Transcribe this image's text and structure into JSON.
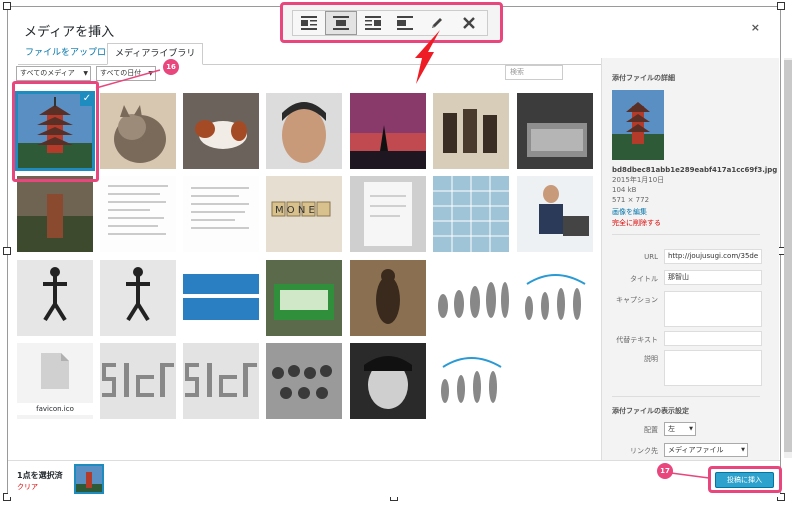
{
  "dialog": {
    "title": "メディアを挿入",
    "close_icon": "×"
  },
  "tabs": [
    {
      "label": "ファイルをアップロード"
    },
    {
      "label": "メディアライブラリ"
    }
  ],
  "toolbar": {
    "buttons": [
      "align-left-icon",
      "align-center-icon",
      "align-right-icon",
      "align-none-icon",
      "edit-pencil-icon",
      "remove-x-icon"
    ],
    "active": "align-center-icon"
  },
  "filters": {
    "type_value": "すべてのメディア",
    "date_value": "すべての日付",
    "search_placeholder": "検索"
  },
  "annotations": {
    "badge_16": "16",
    "badge_17": "17"
  },
  "grid": {
    "rows": [
      [
        "pagoda",
        "cat",
        "dog",
        "man-face",
        "sunset-silhouette",
        "samurai",
        "laptop"
      ],
      [
        "pagoda-blur",
        "document",
        "document-2",
        "money-tiles",
        "document-photo",
        "spreadsheet",
        "businessman"
      ],
      [
        "jump",
        "jump-2",
        "deadman-banner",
        "green-truck",
        "bigfoot",
        "evolution",
        "evolution-logo"
      ],
      [
        "file-icon",
        "5der-text",
        "5der-text-2",
        "group-photo",
        "old-man",
        "evolution-logo-2"
      ]
    ],
    "file_label": "favicon.ico"
  },
  "sidebar": {
    "heading": "添付ファイルの詳細",
    "filename": "bd8dbec81abb1e289eabf417a1cc69f3.jpg",
    "date": "2015年1月10日",
    "size": "104 kB",
    "dimensions": "571 × 772",
    "edit_link": "画像を編集",
    "delete_link": "完全に削除する",
    "fields": {
      "url_label": "URL",
      "url_value": "http://joujusugi.com/35de",
      "title_label": "タイトル",
      "title_value": "那智山",
      "caption_label": "キャプション",
      "alt_label": "代替テキスト",
      "description_label": "説明"
    },
    "display_settings": {
      "heading": "添付ファイルの表示設定",
      "align_label": "配置",
      "align_value": "左",
      "link_label": "リンク先",
      "link_value": "メディアファイル"
    }
  },
  "footer": {
    "selected_count": "1点を選択済",
    "clear_link": "クリア",
    "insert_button": "投稿に挿入"
  },
  "colors": {
    "accent_blue": "#1e8cbe",
    "annotation_pink": "#e8467c",
    "delete_red": "#dd0000",
    "button_blue": "#2ea2cc"
  }
}
